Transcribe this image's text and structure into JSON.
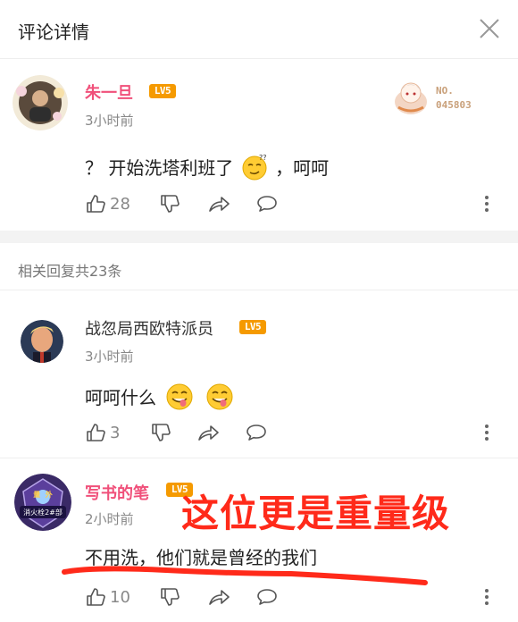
{
  "header": {
    "title": "评论详情"
  },
  "main_comment": {
    "username": "朱一旦",
    "level": "LV5",
    "time": "3小时前",
    "text_before": "？ 开始洗塔利班了",
    "text_after": "，呵呵",
    "likes": "28",
    "badge_line1": "NO.",
    "badge_line2": "045803"
  },
  "replies_count": "相关回复共23条",
  "replies": [
    {
      "username": "战忽局西欧特派员",
      "level": "LV5",
      "time": "3小时前",
      "text": "呵呵什么",
      "likes": "3"
    },
    {
      "username": "写书的笔",
      "level": "LV5",
      "time": "2小时前",
      "text": "不用洗，他们就是曾经的我们",
      "likes": "10",
      "avatar_text_top": "量  外",
      "avatar_text_bottom": "消火栓2#部"
    }
  ],
  "annotation": "这位更是重量级",
  "colors": {
    "vip_name": "#f0507a",
    "level_badge": "#f59a00",
    "annotation": "#ff2a1a"
  }
}
